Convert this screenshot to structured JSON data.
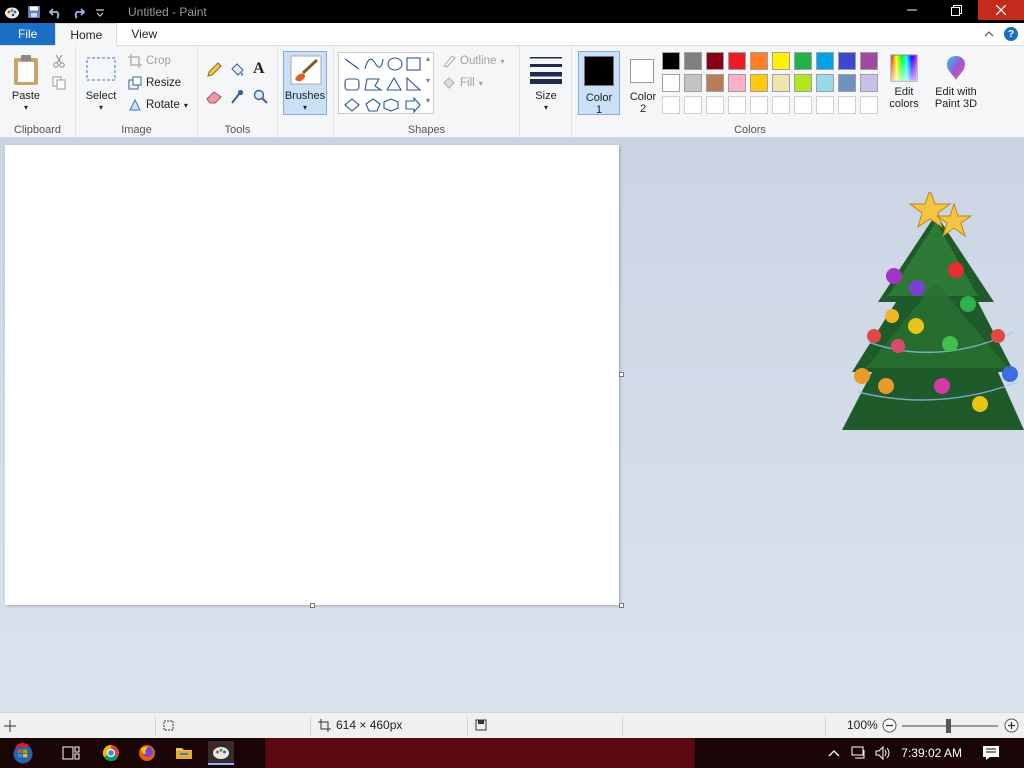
{
  "window": {
    "title": "Untitled - Paint"
  },
  "tabs": {
    "file": "File",
    "home": "Home",
    "view": "View"
  },
  "clipboard": {
    "paste": "Paste",
    "label": "Clipboard"
  },
  "image": {
    "select": "Select",
    "crop": "Crop",
    "resize": "Resize",
    "rotate": "Rotate",
    "label": "Image"
  },
  "tools": {
    "label": "Tools",
    "text_tool": "A"
  },
  "brushes": {
    "label": "Brushes"
  },
  "shapes": {
    "outline": "Outline",
    "fill": "Fill",
    "label": "Shapes"
  },
  "size": {
    "label": "Size"
  },
  "colors": {
    "color1_label": "Color",
    "color1_num": "1",
    "color2_label": "Color",
    "color2_num": "2",
    "label": "Colors",
    "edit_colors_line1": "Edit",
    "edit_colors_line2": "colors",
    "paint3d_line1": "Edit with",
    "paint3d_line2": "Paint 3D",
    "color1_value": "#000000",
    "color2_value": "#ffffff",
    "palette_row1": [
      "#000000",
      "#7f7f7f",
      "#880015",
      "#ed1c24",
      "#ff7f27",
      "#fff200",
      "#22b14c",
      "#00a2e8",
      "#3f48cc",
      "#a349a4"
    ],
    "palette_row2": [
      "#ffffff",
      "#c3c3c3",
      "#b97a57",
      "#ffaec9",
      "#ffc90e",
      "#efe4b0",
      "#b5e61d",
      "#99d9ea",
      "#7092be",
      "#c8bfe7"
    ]
  },
  "status": {
    "canvas_size": "614 × 460px",
    "zoom": "100%"
  },
  "taskbar": {
    "time": "7:39:02 AM"
  }
}
